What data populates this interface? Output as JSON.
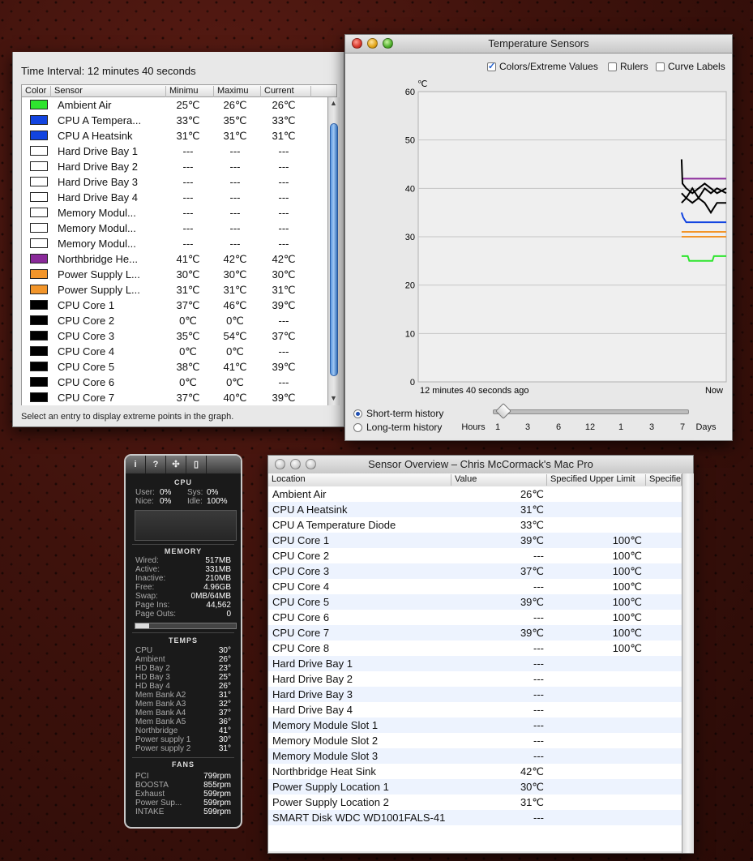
{
  "list_window": {
    "interval": "Time Interval: 12 minutes 40 seconds",
    "columns": [
      "Color",
      "Sensor",
      "Minimu",
      "Maximu",
      "Current"
    ],
    "status": "Select an entry to display extreme points in the graph.",
    "rows": [
      {
        "color": "#2ee52e",
        "name": "Ambient Air",
        "min": "25℃",
        "max": "26℃",
        "cur": "26℃"
      },
      {
        "color": "#1244e0",
        "name": "CPU A Tempera...",
        "min": "33℃",
        "max": "35℃",
        "cur": "33℃"
      },
      {
        "color": "#1244e0",
        "name": "CPU A Heatsink",
        "min": "31℃",
        "max": "31℃",
        "cur": "31℃"
      },
      {
        "color": "#ffffff",
        "name": "Hard Drive Bay 1",
        "min": "---",
        "max": "---",
        "cur": "---"
      },
      {
        "color": "#ffffff",
        "name": "Hard Drive Bay 2",
        "min": "---",
        "max": "---",
        "cur": "---"
      },
      {
        "color": "#ffffff",
        "name": "Hard Drive Bay 3",
        "min": "---",
        "max": "---",
        "cur": "---"
      },
      {
        "color": "#ffffff",
        "name": "Hard Drive Bay 4",
        "min": "---",
        "max": "---",
        "cur": "---"
      },
      {
        "color": "#ffffff",
        "name": "Memory Modul...",
        "min": "---",
        "max": "---",
        "cur": "---"
      },
      {
        "color": "#ffffff",
        "name": "Memory Modul...",
        "min": "---",
        "max": "---",
        "cur": "---"
      },
      {
        "color": "#ffffff",
        "name": "Memory Modul...",
        "min": "---",
        "max": "---",
        "cur": "---"
      },
      {
        "color": "#8a2a9a",
        "name": "Northbridge He...",
        "min": "41℃",
        "max": "42℃",
        "cur": "42℃"
      },
      {
        "color": "#f2952a",
        "name": "Power Supply L...",
        "min": "30℃",
        "max": "30℃",
        "cur": "30℃"
      },
      {
        "color": "#f2952a",
        "name": "Power Supply L...",
        "min": "31℃",
        "max": "31℃",
        "cur": "31℃"
      },
      {
        "color": "#000000",
        "name": "CPU Core 1",
        "min": "37℃",
        "max": "46℃",
        "cur": "39℃"
      },
      {
        "color": "#000000",
        "name": "CPU Core 2",
        "min": "0℃",
        "max": "0℃",
        "cur": "---"
      },
      {
        "color": "#000000",
        "name": "CPU Core 3",
        "min": "35℃",
        "max": "54℃",
        "cur": "37℃"
      },
      {
        "color": "#000000",
        "name": "CPU Core 4",
        "min": "0℃",
        "max": "0℃",
        "cur": "---"
      },
      {
        "color": "#000000",
        "name": "CPU Core 5",
        "min": "38℃",
        "max": "41℃",
        "cur": "39℃"
      },
      {
        "color": "#000000",
        "name": "CPU Core 6",
        "min": "0℃",
        "max": "0℃",
        "cur": "---"
      },
      {
        "color": "#000000",
        "name": "CPU Core 7",
        "min": "37℃",
        "max": "40℃",
        "cur": "39℃"
      }
    ]
  },
  "graph_window": {
    "title": "Temperature Sensors",
    "opt_colors": "Colors/Extreme Values",
    "opt_rulers": "Rulers",
    "opt_curve": "Curve Labels",
    "left_time": "12 minutes 40 seconds ago",
    "right_time": "Now",
    "short_term": "Short-term history",
    "long_term": "Long-term history",
    "hours_label": "Hours",
    "days_label": "Days",
    "slider_ticks": [
      "1",
      "3",
      "6",
      "12",
      "1",
      "3",
      "7"
    ]
  },
  "chart_data": {
    "type": "line",
    "ylabel": "℃",
    "ylim": [
      0,
      60
    ],
    "yticks": [
      0,
      10,
      20,
      30,
      40,
      50,
      60
    ],
    "xlim": [
      0,
      1
    ],
    "grid": true,
    "series": [
      {
        "color": "#8a2a9a",
        "x": [
          0.855,
          1.0
        ],
        "values": [
          42,
          42
        ]
      },
      {
        "color": "#f2952a",
        "x": [
          0.855,
          1.0
        ],
        "values": [
          31,
          31
        ]
      },
      {
        "color": "#f2952a",
        "x": [
          0.855,
          1.0
        ],
        "values": [
          30,
          30
        ]
      },
      {
        "color": "#1244e0",
        "x": [
          0.855,
          0.86,
          0.87,
          1.0
        ],
        "values": [
          35,
          34,
          33,
          33
        ]
      },
      {
        "color": "#2ee52e",
        "x": [
          0.855,
          0.875,
          0.88,
          0.955,
          0.96,
          1.0
        ],
        "values": [
          26,
          26,
          25,
          25,
          26,
          26
        ]
      },
      {
        "color": "#000000",
        "x": [
          0.855,
          0.858,
          0.87,
          0.89,
          0.91,
          0.93,
          0.95,
          0.97,
          1.0
        ],
        "values": [
          46,
          41,
          40,
          39,
          40,
          41,
          40,
          39,
          40
        ]
      },
      {
        "color": "#000000",
        "x": [
          0.855,
          0.87,
          0.89,
          0.91,
          0.93,
          0.95,
          0.97,
          1.0
        ],
        "values": [
          39,
          38,
          40,
          38,
          40,
          39,
          40,
          39
        ]
      },
      {
        "color": "#000000",
        "x": [
          0.855,
          0.87,
          0.89,
          0.91,
          0.93,
          0.95,
          0.97,
          1.0
        ],
        "values": [
          37,
          38,
          37,
          38,
          37,
          35,
          37,
          37
        ]
      }
    ]
  },
  "widget": {
    "tabs": [
      "i",
      "?",
      "✣",
      "▯"
    ],
    "cpu_head": "CPU",
    "cpu_user_l": "User:",
    "cpu_user_v": "0%",
    "cpu_sys_l": "Sys:",
    "cpu_sys_v": "0%",
    "cpu_nice_l": "Nice:",
    "cpu_nice_v": "0%",
    "cpu_idle_l": "Idle:",
    "cpu_idle_v": "100%",
    "mem_head": "MEMORY",
    "memory": [
      {
        "label": "Wired:",
        "value": "517MB"
      },
      {
        "label": "Active:",
        "value": "331MB"
      },
      {
        "label": "Inactive:",
        "value": "210MB"
      },
      {
        "label": "Free:",
        "value": "4.96GB"
      },
      {
        "label": "Swap:",
        "value": "0MB/64MB"
      },
      {
        "label": "Page Ins:",
        "value": "44,562"
      },
      {
        "label": "Page Outs:",
        "value": "0"
      }
    ],
    "temps_head": "TEMPS",
    "temps": [
      {
        "label": "CPU",
        "value": "30°"
      },
      {
        "label": "Ambient",
        "value": "26°"
      },
      {
        "label": "HD Bay 2",
        "value": "23°"
      },
      {
        "label": "HD Bay 3",
        "value": "25°"
      },
      {
        "label": "HD Bay 4",
        "value": "26°"
      },
      {
        "label": "Mem Bank A2",
        "value": "31°"
      },
      {
        "label": "Mem Bank A3",
        "value": "32°"
      },
      {
        "label": "Mem Bank A4",
        "value": "37°"
      },
      {
        "label": "Mem Bank A5",
        "value": "36°"
      },
      {
        "label": "Northbridge",
        "value": "41°"
      },
      {
        "label": "Power supply 1",
        "value": "30°"
      },
      {
        "label": "Power supply 2",
        "value": "31°"
      }
    ],
    "fans_head": "FANS",
    "fans": [
      {
        "label": "PCI",
        "value": "799rpm"
      },
      {
        "label": "BOOSTA",
        "value": "855rpm"
      },
      {
        "label": "Exhaust",
        "value": "599rpm"
      },
      {
        "label": "Power Sup...",
        "value": "599rpm"
      },
      {
        "label": "INTAKE",
        "value": "599rpm"
      }
    ]
  },
  "overview_window": {
    "title": "Sensor Overview – Chris McCormack's Mac Pro",
    "columns": [
      "Location",
      "Value",
      "Specified Upper Limit",
      "Specifie"
    ],
    "rows": [
      {
        "loc": "Ambient Air",
        "val": "26℃",
        "lim": ""
      },
      {
        "loc": "CPU A Heatsink",
        "val": "31℃",
        "lim": ""
      },
      {
        "loc": "CPU A Temperature Diode",
        "val": "33℃",
        "lim": ""
      },
      {
        "loc": "CPU Core 1",
        "val": "39℃",
        "lim": "100℃"
      },
      {
        "loc": "CPU Core 2",
        "val": "---",
        "lim": "100℃"
      },
      {
        "loc": "CPU Core 3",
        "val": "37℃",
        "lim": "100℃"
      },
      {
        "loc": "CPU Core 4",
        "val": "---",
        "lim": "100℃"
      },
      {
        "loc": "CPU Core 5",
        "val": "39℃",
        "lim": "100℃"
      },
      {
        "loc": "CPU Core 6",
        "val": "---",
        "lim": "100℃"
      },
      {
        "loc": "CPU Core 7",
        "val": "39℃",
        "lim": "100℃"
      },
      {
        "loc": "CPU Core 8",
        "val": "---",
        "lim": "100℃"
      },
      {
        "loc": "Hard Drive Bay 1",
        "val": "---",
        "lim": ""
      },
      {
        "loc": "Hard Drive Bay 2",
        "val": "---",
        "lim": ""
      },
      {
        "loc": "Hard Drive Bay 3",
        "val": "---",
        "lim": ""
      },
      {
        "loc": "Hard Drive Bay 4",
        "val": "---",
        "lim": ""
      },
      {
        "loc": "Memory Module Slot 1",
        "val": "---",
        "lim": ""
      },
      {
        "loc": "Memory Module Slot 2",
        "val": "---",
        "lim": ""
      },
      {
        "loc": "Memory Module Slot 3",
        "val": "---",
        "lim": ""
      },
      {
        "loc": "Northbridge Heat Sink",
        "val": "42℃",
        "lim": ""
      },
      {
        "loc": "Power Supply Location 1",
        "val": "30℃",
        "lim": ""
      },
      {
        "loc": "Power Supply Location 2",
        "val": "31℃",
        "lim": ""
      },
      {
        "loc": "SMART Disk WDC WD1001FALS-41",
        "val": "---",
        "lim": ""
      }
    ]
  }
}
